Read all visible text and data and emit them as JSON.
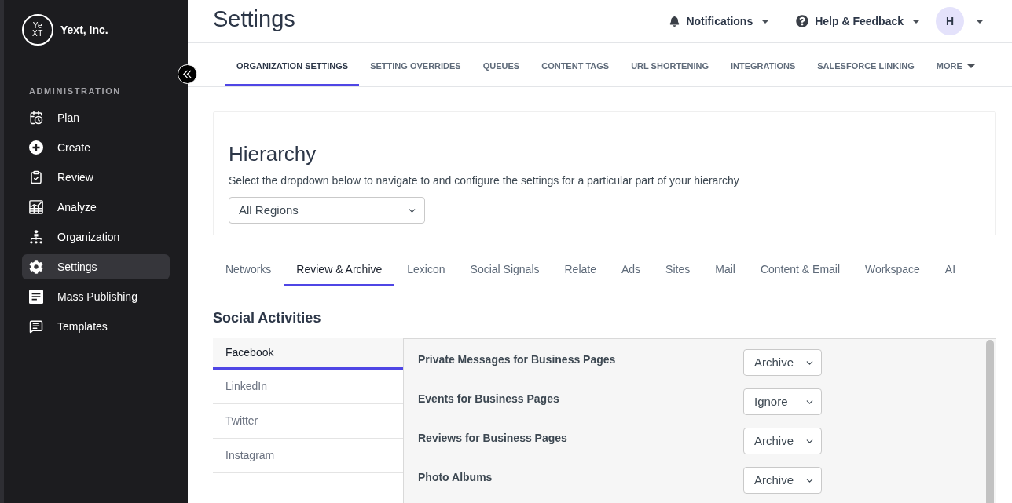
{
  "sidebar": {
    "logo": {
      "lines": [
        "Ye",
        "XT"
      ]
    },
    "brand": "Yext, Inc.",
    "section_label": "ADMINISTRATION",
    "items": [
      {
        "label": "Plan",
        "selected": false
      },
      {
        "label": "Create",
        "selected": false
      },
      {
        "label": "Review",
        "selected": false
      },
      {
        "label": "Analyze",
        "selected": false
      },
      {
        "label": "Organization",
        "selected": false
      },
      {
        "label": "Settings",
        "selected": true
      },
      {
        "label": "Mass Publishing",
        "selected": false
      },
      {
        "label": "Templates",
        "selected": false
      }
    ]
  },
  "header": {
    "title": "Settings",
    "notifications": "Notifications",
    "help": "Help & Feedback",
    "avatar": "H"
  },
  "top_tabs": [
    {
      "label": "ORGANIZATION SETTINGS",
      "kind": "tab",
      "selected": true
    },
    {
      "label": "SETTING OVERRIDES",
      "kind": "tab",
      "selected": false
    },
    {
      "label": "QUEUES",
      "kind": "tab",
      "selected": false
    },
    {
      "label": "CONTENT TAGS",
      "kind": "tab",
      "selected": false
    },
    {
      "label": "URL SHORTENING",
      "kind": "tab",
      "selected": false
    },
    {
      "label": "INTEGRATIONS",
      "kind": "tab",
      "selected": false
    },
    {
      "label": "SALESFORCE LINKING",
      "kind": "tab",
      "selected": false
    },
    {
      "label": "MORE",
      "kind": "menu",
      "selected": false
    }
  ],
  "hierarchy": {
    "title": "Hierarchy",
    "description": "Select the dropdown below to navigate to and configure the settings for a particular part of your hierarchy",
    "select": {
      "value": "All Regions"
    }
  },
  "section_tabs": [
    {
      "label": "Networks",
      "selected": false
    },
    {
      "label": "Review & Archive",
      "selected": true
    },
    {
      "label": "Lexicon",
      "selected": false
    },
    {
      "label": "Social Signals",
      "selected": false
    },
    {
      "label": "Relate",
      "selected": false
    },
    {
      "label": "Ads",
      "selected": false
    },
    {
      "label": "Sites",
      "selected": false
    },
    {
      "label": "Mail",
      "selected": false
    },
    {
      "label": "Content & Email",
      "selected": false
    },
    {
      "label": "Workspace",
      "selected": false
    },
    {
      "label": "AI",
      "selected": false
    }
  ],
  "social_activities": {
    "title": "Social Activities",
    "networks": [
      {
        "label": "Facebook",
        "selected": true
      },
      {
        "label": "LinkedIn",
        "selected": false
      },
      {
        "label": "Twitter",
        "selected": false
      },
      {
        "label": "Instagram",
        "selected": false
      }
    ],
    "settings": [
      {
        "label": "Private Messages for Business Pages",
        "value": "Archive"
      },
      {
        "label": "Events for Business Pages",
        "value": "Ignore"
      },
      {
        "label": "Reviews for Business Pages",
        "value": "Archive"
      },
      {
        "label": "Photo Albums",
        "value": "Archive"
      }
    ]
  }
}
